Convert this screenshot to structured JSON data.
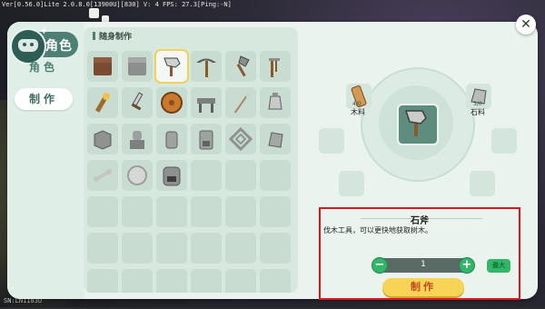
{
  "debug": {
    "text": "Ver[0.56.0]Lite 2.0.8.0[13900U][830] V: 4 FPS: 27.3[Ping:-N]"
  },
  "version": {
    "text": "SN:LN1183U"
  },
  "header": {
    "title": "角色"
  },
  "sidebar": {
    "items": [
      {
        "label": "角色",
        "active": false
      },
      {
        "label": "制作",
        "active": true
      }
    ]
  },
  "grid": {
    "title": "随身制作",
    "items": [
      {
        "icon": "dirt-block-icon"
      },
      {
        "icon": "stone-block-icon"
      },
      {
        "icon": "stone-axe-icon",
        "selected": true
      },
      {
        "icon": "pickaxe-icon"
      },
      {
        "icon": "shovel-icon"
      },
      {
        "icon": "hoe-icon"
      },
      {
        "icon": "torch-icon"
      },
      {
        "icon": "sword-icon"
      },
      {
        "icon": "shield-icon"
      },
      {
        "icon": "workbench-icon"
      },
      {
        "icon": "spear-icon"
      },
      {
        "icon": "lantern-icon"
      },
      {
        "icon": "stone-pile-icon"
      },
      {
        "icon": "statue-icon"
      },
      {
        "icon": "jar-icon"
      },
      {
        "icon": "stove-icon"
      },
      {
        "icon": "lattice-icon"
      },
      {
        "icon": "stone-chunk-icon"
      },
      {
        "icon": "bone-icon"
      },
      {
        "icon": "plate-icon"
      },
      {
        "icon": "furnace-icon"
      },
      {},
      {},
      {},
      {},
      {},
      {},
      {},
      {},
      {},
      {},
      {},
      {},
      {},
      {},
      {},
      {},
      {},
      {},
      {},
      {},
      {}
    ]
  },
  "recipe": {
    "result_icon": "stone-axe-icon",
    "materials": [
      {
        "name": "木料",
        "qty": "4/0",
        "icon": "wood-icon"
      },
      {
        "name": "石料",
        "qty": "3/0",
        "icon": "stone-icon"
      }
    ]
  },
  "info": {
    "title": "石斧",
    "description": "伐木工具，可以更快地获取树木。",
    "quantity": "1",
    "minus_label": "−",
    "plus_label": "+",
    "max_label": "最大",
    "craft_label": "制作"
  },
  "close": {
    "label": "✕"
  }
}
